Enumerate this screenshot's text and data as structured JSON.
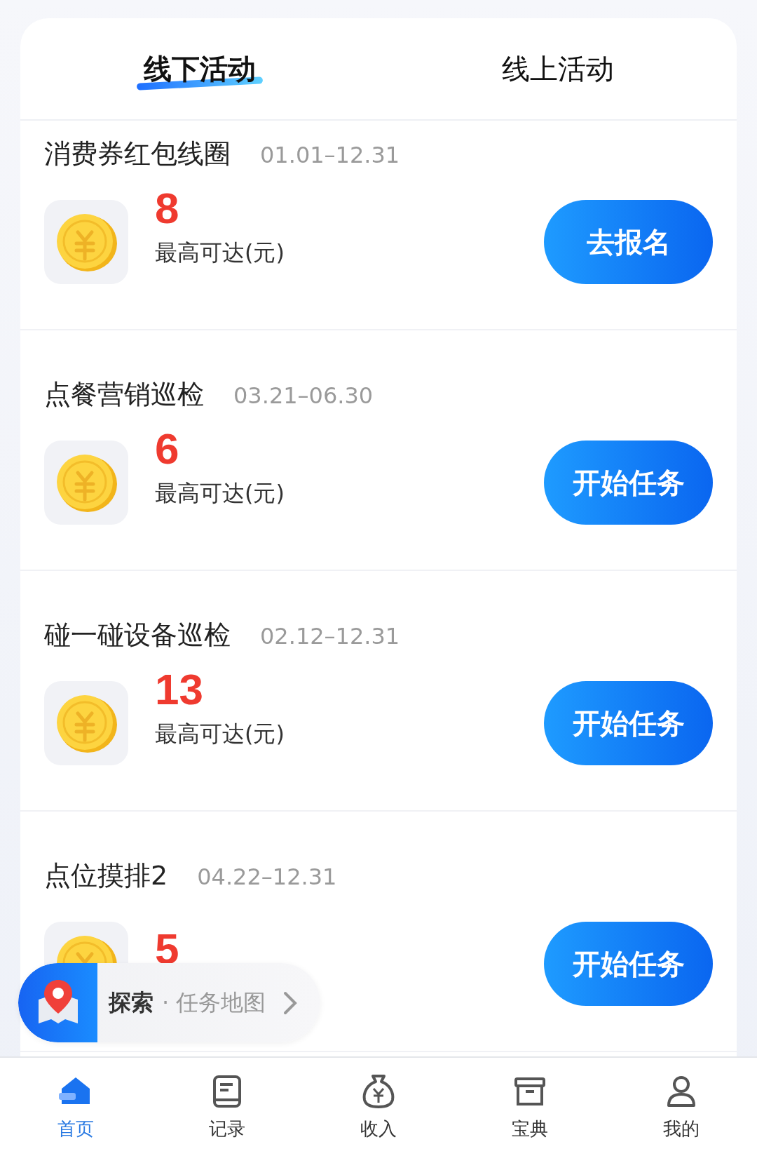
{
  "tabs": [
    {
      "label": "线下活动",
      "selected": true
    },
    {
      "label": "线上活动",
      "selected": false
    }
  ],
  "activities": [
    {
      "title": "消费券红包线圈",
      "dates": "01.01–12.31",
      "amount": "8",
      "amount_label": "最高可达(元)",
      "button": "去报名"
    },
    {
      "title": "点餐营销巡检",
      "dates": "03.21–06.30",
      "amount": "6",
      "amount_label": "最高可达(元)",
      "button": "开始任务"
    },
    {
      "title": "碰一碰设备巡检",
      "dates": "02.12–12.31",
      "amount": "13",
      "amount_label": "最高可达(元)",
      "button": "开始任务"
    },
    {
      "title": "点位摸排2",
      "dates": "04.22–12.31",
      "amount": "5",
      "button": "开始任务"
    }
  ],
  "map_button": {
    "label": "探索",
    "sub_label": "· 任务地图"
  },
  "bottom_nav": [
    {
      "label": "首页",
      "kind": "home",
      "selected": true
    },
    {
      "label": "记录",
      "kind": "record",
      "selected": false
    },
    {
      "label": "收入",
      "kind": "income",
      "selected": false
    },
    {
      "label": "宝典",
      "kind": "box",
      "selected": false
    },
    {
      "label": "我的",
      "kind": "user",
      "selected": false
    }
  ]
}
